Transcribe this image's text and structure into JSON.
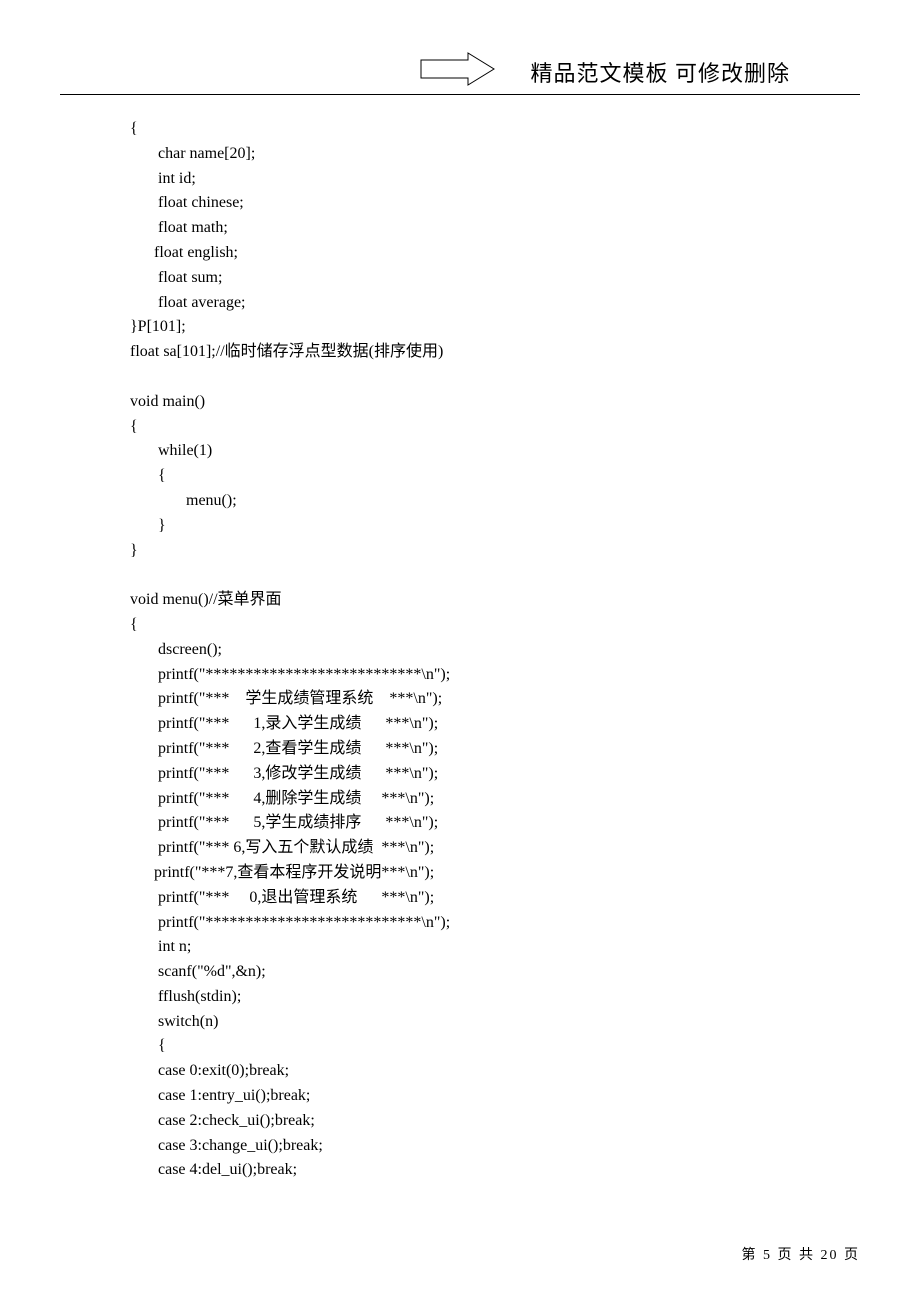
{
  "header": {
    "title": "精品范文模板 可修改删除"
  },
  "code": {
    "lines": [
      "{",
      "       char name[20];",
      "       int id;",
      "       float chinese;",
      "       float math;",
      "      float english;",
      "       float sum;",
      "       float average;",
      "}P[101];",
      "float sa[101];//临时储存浮点型数据(排序使用)",
      "",
      "void main()",
      "{",
      "       while(1)",
      "       {",
      "              menu();",
      "       }",
      "}",
      "",
      "void menu()//菜单界面",
      "{",
      "       dscreen();",
      "       printf(\"***************************\\n\");",
      "       printf(\"***    学生成绩管理系统    ***\\n\");",
      "       printf(\"***      1,录入学生成绩      ***\\n\");",
      "       printf(\"***      2,查看学生成绩      ***\\n\");",
      "       printf(\"***      3,修改学生成绩      ***\\n\");",
      "       printf(\"***      4,删除学生成绩     ***\\n\");",
      "       printf(\"***      5,学生成绩排序      ***\\n\");",
      "       printf(\"*** 6,写入五个默认成绩  ***\\n\");",
      "      printf(\"***7,查看本程序开发说明***\\n\");",
      "       printf(\"***     0,退出管理系统      ***\\n\");",
      "       printf(\"***************************\\n\");",
      "       int n;",
      "       scanf(\"%d\",&n);",
      "       fflush(stdin);",
      "       switch(n)",
      "       {",
      "       case 0:exit(0);break;",
      "       case 1:entry_ui();break;",
      "       case 2:check_ui();break;",
      "       case 3:change_ui();break;",
      "       case 4:del_ui();break;"
    ]
  },
  "footer": {
    "prefix": "第",
    "current": "5",
    "mid": "页 共",
    "total": "20",
    "suffix": "页"
  }
}
